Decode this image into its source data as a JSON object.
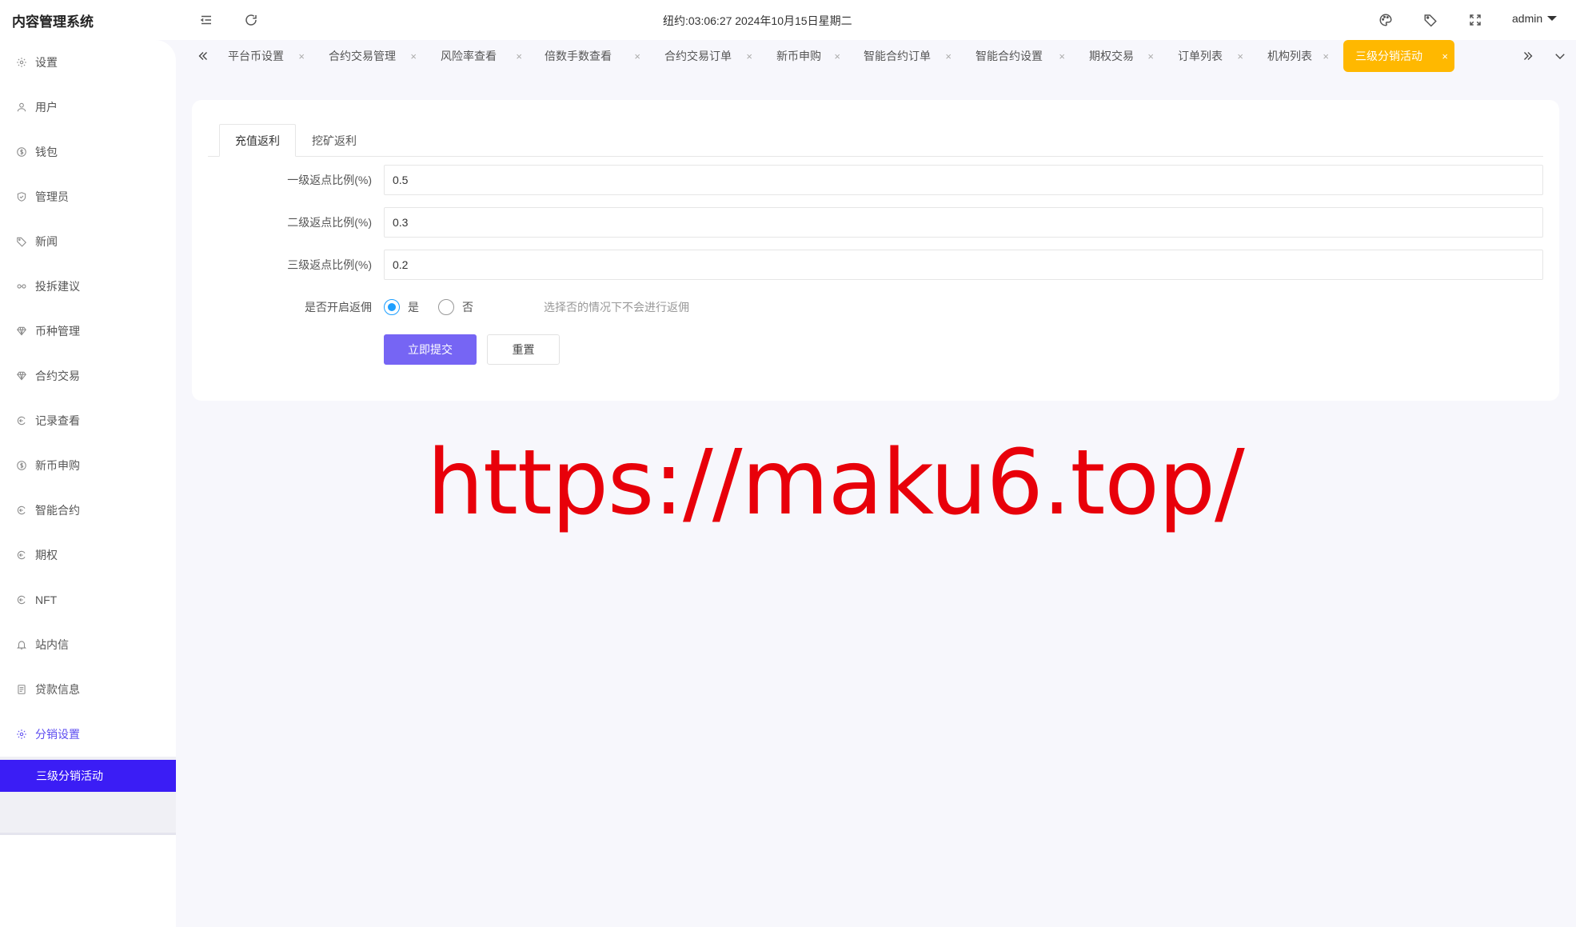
{
  "header": {
    "app_title": "内容管理系统",
    "clock": "纽约:03:06:27 2024年10月15日星期二",
    "user": "admin"
  },
  "sidebar": {
    "items": [
      {
        "label": "设置",
        "icon": "gear-icon"
      },
      {
        "label": "用户",
        "icon": "user-icon"
      },
      {
        "label": "钱包",
        "icon": "dollar-icon"
      },
      {
        "label": "管理员",
        "icon": "shield-icon"
      },
      {
        "label": "新闻",
        "icon": "tag-icon"
      },
      {
        "label": "投拆建议",
        "icon": "link-icon"
      },
      {
        "label": "币种管理",
        "icon": "diamond-icon"
      },
      {
        "label": "合约交易",
        "icon": "diamond-icon"
      },
      {
        "label": "记录查看",
        "icon": "circle-arrow-icon"
      },
      {
        "label": "新币申购",
        "icon": "dollar-icon"
      },
      {
        "label": "智能合约",
        "icon": "circle-arrow-icon"
      },
      {
        "label": "期权",
        "icon": "circle-arrow-icon"
      },
      {
        "label": "NFT",
        "icon": "circle-arrow-icon"
      },
      {
        "label": "站内信",
        "icon": "bell-icon"
      },
      {
        "label": "贷款信息",
        "icon": "document-icon"
      },
      {
        "label": "分销设置",
        "icon": "gear-icon"
      }
    ],
    "submenu_active": "三级分销活动"
  },
  "tabs": {
    "items": [
      "平台币设置",
      "合约交易管理",
      "风险率查看",
      "倍数手数查看",
      "合约交易订单",
      "新币申购",
      "智能合约订单",
      "智能合约设置",
      "期权交易",
      "订单列表",
      "机构列表",
      "三级分销活动"
    ],
    "close_glyph": "×",
    "active_color": "#ffb800"
  },
  "form": {
    "tabs": [
      "充值返利",
      "挖矿返利"
    ],
    "fields": [
      {
        "label": "一级返点比例(%)",
        "value": "0.5"
      },
      {
        "label": "二级返点比例(%)",
        "value": "0.3"
      },
      {
        "label": "三级返点比例(%)",
        "value": "0.2"
      }
    ],
    "toggle": {
      "label": "是否开启返佣",
      "options": [
        "是",
        "否"
      ],
      "selected": "是",
      "hint": "选择否的情况下不会进行返佣"
    },
    "submit_label": "立即提交",
    "reset_label": "重置"
  },
  "watermark": "https://maku6.top/"
}
